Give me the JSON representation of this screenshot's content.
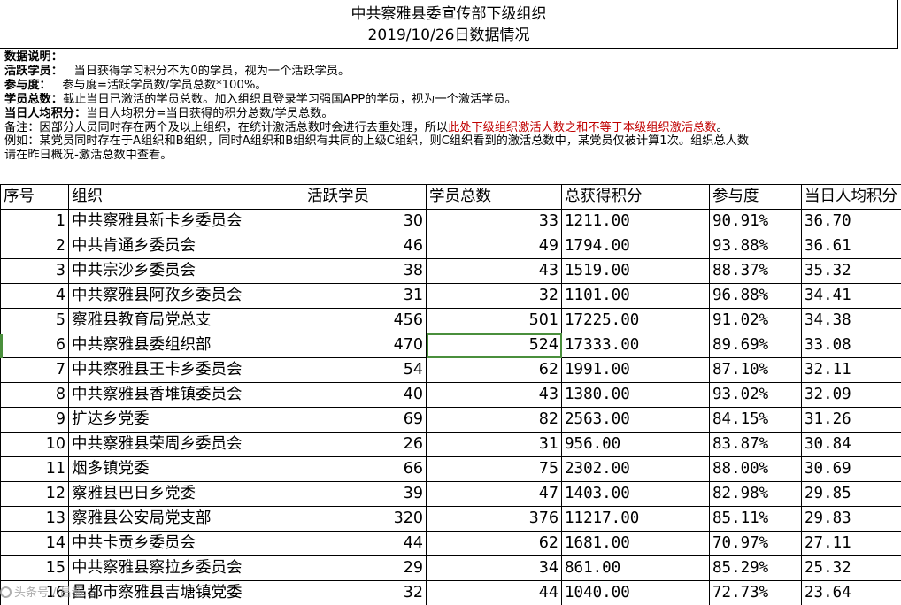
{
  "title": {
    "line1": "中共察雅县委宣传部下级组织",
    "line2": "2019/10/26日数据情况"
  },
  "notes": {
    "heading": "数据说明：",
    "active_label": "活跃学员：",
    "active_text": "当日获得学习积分不为0的学员，视为一个活跃学员。",
    "participation_label": "参与度：",
    "participation_text": "参与度=活跃学员数/学员总数*100%。",
    "total_label": "学员总数：",
    "total_text": "截止当日已激活的学员总数。加入组织且登录学习强国APP的学员，视为一个激活学员。",
    "avg_label": "当日人均积分：",
    "avg_text": "当日人均积分=当日获得的积分总数/学员总数。",
    "remark_prefix": "备注：因部分人员同时存在两个及以上组织，在统计激活总数时会进行去重处理，所以",
    "remark_red": "此处下级组织激活人数之和不等于本级组织激活总数",
    "remark_suffix": "。",
    "example_line1": "例如：某党员同时存在于A组织和B组织，同时A组织和B组织有共同的上级C组织，则C组织看到的激活总数中，某党员仅被计算1次。组织总人数",
    "example_line2": "请在昨日概况-激活总数中查看。"
  },
  "table": {
    "headers": [
      "序号",
      "组织",
      "活跃学员",
      "学员总数",
      "总获得积分",
      "参与度",
      "当日人均积分"
    ],
    "rows": [
      [
        "1",
        "中共察雅县新卡乡委员会",
        "30",
        "33",
        "1211.00",
        "90.91%",
        "36.70"
      ],
      [
        "2",
        "中共肯通乡委员会",
        "46",
        "49",
        "1794.00",
        "93.88%",
        "36.61"
      ],
      [
        "3",
        "中共宗沙乡委员会",
        "38",
        "43",
        "1519.00",
        "88.37%",
        "35.32"
      ],
      [
        "4",
        "中共察雅县阿孜乡委员会",
        "31",
        "32",
        "1101.00",
        "96.88%",
        "34.41"
      ],
      [
        "5",
        "察雅县教育局党总支",
        "456",
        "501",
        "17225.00",
        "91.02%",
        "34.38"
      ],
      [
        "6",
        "中共察雅县委组织部",
        "470",
        "524",
        "17333.00",
        "89.69%",
        "33.08"
      ],
      [
        "7",
        "中共察雅县王卡乡委员会",
        "54",
        "62",
        "1991.00",
        "87.10%",
        "32.11"
      ],
      [
        "8",
        "中共察雅县香堆镇委员会",
        "40",
        "43",
        "1380.00",
        "93.02%",
        "32.09"
      ],
      [
        "9",
        "扩达乡党委",
        "69",
        "82",
        "2563.00",
        "84.15%",
        "31.26"
      ],
      [
        "10",
        "中共察雅县荣周乡委员会",
        "26",
        "31",
        "956.00",
        "83.87%",
        "30.84"
      ],
      [
        "11",
        "烟多镇党委",
        "66",
        "75",
        "2302.00",
        "88.00%",
        "30.69"
      ],
      [
        "12",
        "察雅县巴日乡党委",
        "39",
        "47",
        "1403.00",
        "82.98%",
        "29.85"
      ],
      [
        "13",
        "察雅县公安局党支部",
        "320",
        "376",
        "11217.00",
        "85.11%",
        "29.83"
      ],
      [
        "14",
        "中共卡贡乡委员会",
        "44",
        "62",
        "1681.00",
        "70.97%",
        "27.11"
      ],
      [
        "15",
        "中共察雅县察拉乡委员会",
        "29",
        "34",
        "861.00",
        "85.29%",
        "25.32"
      ],
      [
        "16",
        "昌都市察雅县吉塘镇党委",
        "32",
        "44",
        "1040.00",
        "72.73%",
        "23.64"
      ]
    ],
    "selected_row": 6,
    "selected_col": 3
  },
  "watermark": "头条号 / 昌都..."
}
